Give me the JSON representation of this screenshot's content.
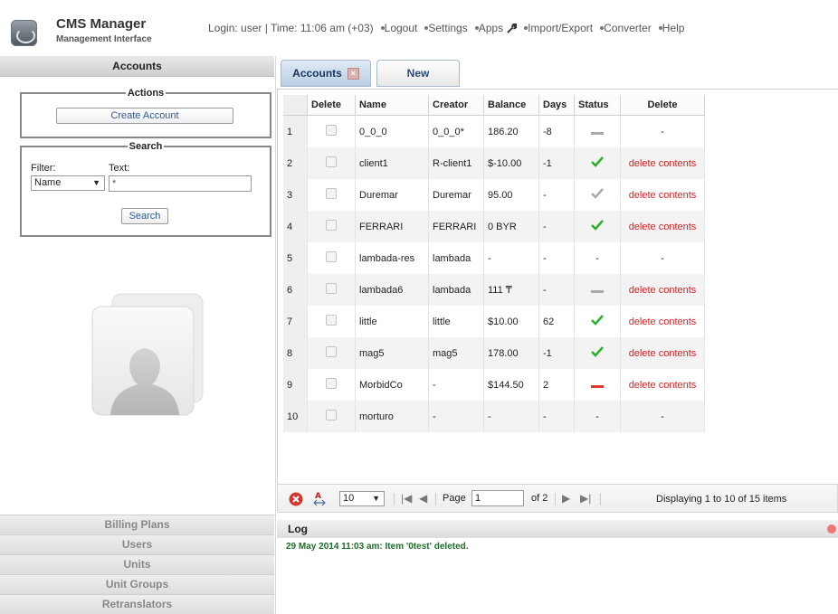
{
  "header": {
    "title": "CMS Manager",
    "subtitle": "Management Interface",
    "status": "Login: user | Time: 11:06 am (+03)",
    "nav": [
      "Logout",
      "Settings",
      "Apps",
      "Import/Export",
      "Converter",
      "Help"
    ]
  },
  "sidebar": {
    "title": "Accounts",
    "actions_legend": "Actions",
    "create_label": "Create Account",
    "search_legend": "Search",
    "filter_label": "Filter:",
    "text_label": "Text:",
    "filter_value": "Name",
    "text_value": "*",
    "search_button": "Search",
    "bottom_items": [
      "Billing Plans",
      "Users",
      "Units",
      "Unit Groups",
      "Retranslators"
    ]
  },
  "tabs": {
    "accounts": "Accounts",
    "new": "New"
  },
  "grid": {
    "columns": [
      "Delete",
      "Name",
      "Creator",
      "Balance",
      "Days",
      "Status",
      "Delete"
    ],
    "rows": [
      {
        "n": "1",
        "name": "0_0_0",
        "creator": "0_0_0*",
        "balance": "186.20",
        "days": "-8",
        "status": "grey",
        "del": "-"
      },
      {
        "n": "2",
        "name": "client1",
        "creator": "R-client1",
        "balance": "$-10.00",
        "days": "-1",
        "status": "green",
        "del": "delete contents"
      },
      {
        "n": "3",
        "name": "Duremar",
        "creator": "Duremar",
        "balance": "95.00",
        "days": "-",
        "status": "greycheck",
        "del": "delete contents"
      },
      {
        "n": "4",
        "name": "FERRARI",
        "creator": "FERRARI",
        "balance": "0 BYR",
        "days": "-",
        "status": "green",
        "del": "delete contents"
      },
      {
        "n": "5",
        "name": "lambada-res",
        "creator": "lambada",
        "balance": "-",
        "days": "-",
        "status": "dash",
        "del": "-"
      },
      {
        "n": "6",
        "name": "lambada6",
        "creator": "lambada",
        "balance": "111 ₸",
        "days": "-",
        "status": "grey",
        "del": "delete contents"
      },
      {
        "n": "7",
        "name": "little",
        "creator": "little",
        "balance": "$10.00",
        "days": "62",
        "status": "green",
        "del": "delete contents"
      },
      {
        "n": "8",
        "name": "mag5",
        "creator": "mag5",
        "balance": "178.00",
        "days": "-1",
        "status": "green",
        "del": "delete contents"
      },
      {
        "n": "9",
        "name": "MorbidCo",
        "creator": "-",
        "balance": "$144.50",
        "days": "2",
        "status": "red",
        "del": "delete contents"
      },
      {
        "n": "10",
        "name": "morturo",
        "creator": "-",
        "balance": "-",
        "days": "-",
        "status": "dash",
        "del": "-"
      }
    ]
  },
  "pager": {
    "page_size": "10",
    "page_label": "Page",
    "page_value": "1",
    "of_label": "of 2",
    "summary": "Displaying 1 to 10 of 15 items"
  },
  "log": {
    "title": "Log",
    "line": "29 May 2014 11:03 am: Item '0test' deleted."
  },
  "colors": {
    "status_green": "#2bb02b",
    "status_red": "#e03a30",
    "delete_red": "#e02020"
  }
}
